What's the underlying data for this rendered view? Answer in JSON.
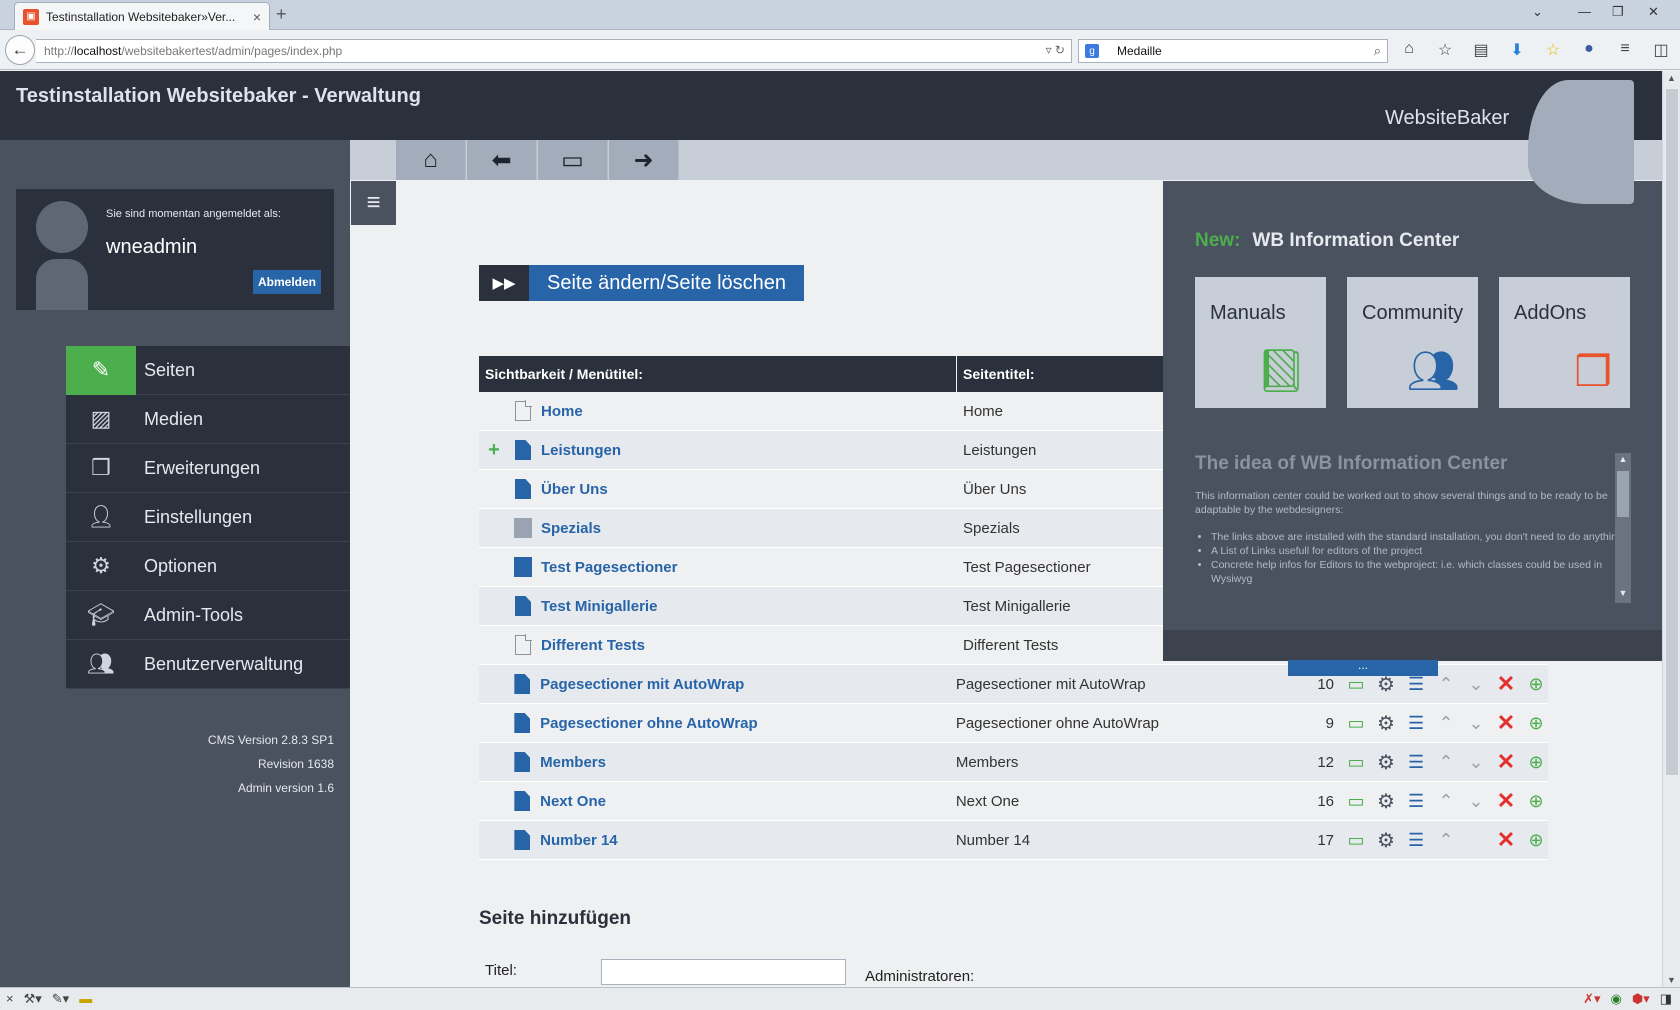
{
  "browser": {
    "tab_title": "Testinstallation Websitebaker»Ver...",
    "tab_close": "×",
    "new_tab": "+",
    "url_prefix": "http://",
    "url_host": "localhost",
    "url_path": "/websitebakertest/admin/pages/index.php",
    "search_value": "Medaille",
    "window_controls": [
      "⌄",
      "—",
      "❐",
      "✕"
    ]
  },
  "header": {
    "title": "Testinstallation Websitebaker - Verwaltung",
    "logo_text": "WebsiteBaker"
  },
  "user": {
    "intro": "Sie sind momentan angemeldet als:",
    "name": "wneadmin",
    "logout_label": "Abmelden"
  },
  "menu": {
    "items": [
      {
        "label": "Seiten",
        "icon": "edit-icon"
      },
      {
        "label": "Medien",
        "icon": "image-icon"
      },
      {
        "label": "Erweiterungen",
        "icon": "cubes-icon"
      },
      {
        "label": "Einstellungen",
        "icon": "user-icon"
      },
      {
        "label": "Optionen",
        "icon": "gears-icon"
      },
      {
        "label": "Admin-Tools",
        "icon": "graduation-cap-icon"
      },
      {
        "label": "Benutzerverwaltung",
        "icon": "users-icon"
      }
    ]
  },
  "version": {
    "cms": "CMS Version 2.8.3 SP1",
    "revision": "Revision 1638",
    "admin": "Admin version 1.6"
  },
  "toolbar": {
    "icons": [
      "home-icon",
      "back-icon",
      "monitor-icon",
      "logout-icon"
    ]
  },
  "page_action": {
    "label": "Seite ändern/Seite löschen"
  },
  "pages_table": {
    "header_menu_title": "Sichtbarkeit / Menütitel:",
    "header_page_title": "Seitentitel:",
    "rows": [
      {
        "menu_title": "Home",
        "page_title": "Home",
        "visibility": "hidden",
        "expander": "",
        "id": ""
      },
      {
        "menu_title": "Leistungen",
        "page_title": "Leistungen",
        "visibility": "public",
        "expander": "+",
        "id": ""
      },
      {
        "menu_title": "Über Uns",
        "page_title": "Über Uns",
        "visibility": "public",
        "expander": "",
        "id": ""
      },
      {
        "menu_title": "Spezials",
        "page_title": "Spezials",
        "visibility": "registered",
        "expander": "",
        "id": ""
      },
      {
        "menu_title": "Test Pagesectioner",
        "page_title": "Test Pagesectioner",
        "visibility": "private",
        "expander": "",
        "id": ""
      },
      {
        "menu_title": "Test Minigallerie",
        "page_title": "Test Minigallerie",
        "visibility": "public",
        "expander": "",
        "id": ""
      },
      {
        "menu_title": "Different Tests",
        "page_title": "Different Tests",
        "visibility": "hidden",
        "expander": "",
        "id": ""
      },
      {
        "menu_title": "Pagesectioner mit AutoWrap",
        "page_title": "Pagesectioner mit AutoWrap",
        "visibility": "public",
        "expander": "",
        "id": "10"
      },
      {
        "menu_title": "Pagesectioner ohne AutoWrap",
        "page_title": "Pagesectioner ohne AutoWrap",
        "visibility": "public",
        "expander": "",
        "id": "9"
      },
      {
        "menu_title": "Members",
        "page_title": "Members",
        "visibility": "public",
        "expander": "",
        "id": "12"
      },
      {
        "menu_title": "Next One",
        "page_title": "Next One",
        "visibility": "public",
        "expander": "",
        "id": "16"
      },
      {
        "menu_title": "Number 14",
        "page_title": "Number 14",
        "visibility": "public",
        "expander": "",
        "id": "17"
      }
    ]
  },
  "add_page": {
    "heading": "Seite hinzufügen",
    "title_label": "Titel:",
    "title_value": "",
    "admins_label": "Administratoren:"
  },
  "info_center": {
    "new_label": "New:",
    "name": "WB Information Center",
    "tiles": [
      {
        "label": "Manuals",
        "icon": "book-icon"
      },
      {
        "label": "Community",
        "icon": "users-icon"
      },
      {
        "label": "AddOns",
        "icon": "cubes-icon"
      }
    ],
    "text_title": "The idea of WB Information Center",
    "text_intro": "This information center could be worked out to show several things and to be ready to be adaptable by the webdesigners:",
    "bullets": [
      "The links above are installed with the standard installation, you don't need to do anything",
      "A List of Links usefull for editors of the project",
      "Concrete help infos for Editors to the webproject: i.e. which classes could be used in Wysiwyg"
    ],
    "tab_label": "..."
  },
  "colors": {
    "dark": "#2b313c",
    "sidebar": "#4a5260",
    "accent_blue": "#2764a8",
    "accent_green": "#4cae4c",
    "delete_red": "#e3302d"
  }
}
